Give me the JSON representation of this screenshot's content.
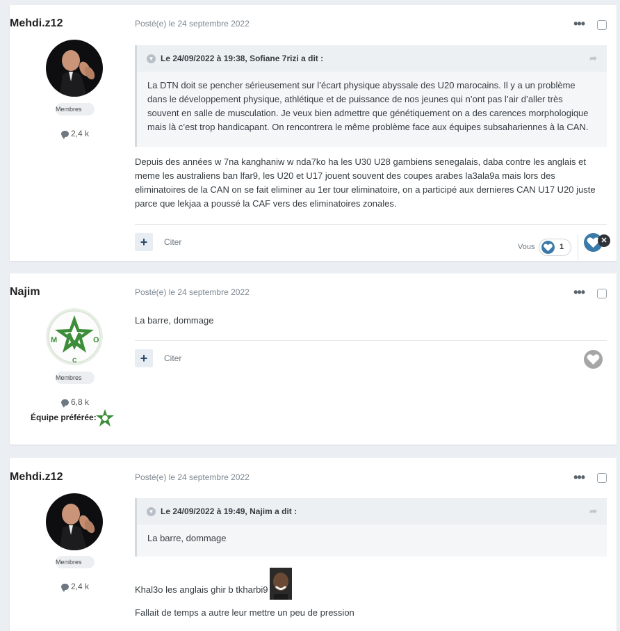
{
  "posts": [
    {
      "author": "Mehdi.z12",
      "role": "Membres",
      "rep": "2,4 k",
      "date": "Posté(e) le 24 septembre 2022",
      "quote": {
        "header": "Le 24/09/2022 à 19:38, Sofiane 7rizi a dit :",
        "body": "La DTN doit se pencher sérieusement sur l’écart physique abyssale des U20 marocains. Il y a un problème dans le développement physique, athlétique et de puissance de nos jeunes qui n’ont pas l’air d’aller très souvent en salle de musculation. Je veux bien admettre que génétiquement on a des carences morphologique mais là c’est trop handicapant. On rencontrera le même problème face aux équipes subsahariennes à la CAN."
      },
      "text": "Depuis des années w 7na kanghaniw w nda7ko ha les U30 U28 gambiens senegalais, daba contre les anglais et meme les australiens ban lfar9, les U20 et U17 jouent souvent des coupes arabes la3ala9a mais lors des eliminatoires de la CAN on se fait eliminer au 1er tour eliminatoire, on a participé aux dernieres CAN U17 U20 juste parce que lekjaa a poussé la CAF vers des eliminatoires zonales.",
      "cite": "Citer",
      "reaction_user": "Vous",
      "reaction_count": "1"
    },
    {
      "author": "Najim",
      "role": "Membres",
      "rep": "6,8 k",
      "fav_label": "Équipe préférée:",
      "date": "Posté(e) le 24 septembre 2022",
      "text": "La barre, dommage",
      "cite": "Citer"
    },
    {
      "author": "Mehdi.z12",
      "role": "Membres",
      "rep": "2,4 k",
      "date": "Posté(e) le 24 septembre 2022",
      "quote": {
        "header": "Le 24/09/2022 à 19:49, Najim a dit :",
        "body": "La barre, dommage"
      },
      "text": "Khal3o les anglais ghir b tkharbi9",
      "text2": "Fallait de temps a autre leur mettre un peu de pression"
    }
  ],
  "logo_letters": {
    "m": "M",
    "o": "O",
    "c": "C"
  },
  "colors": {
    "accent": "#3b7aa8",
    "logo_green": "#3c8d3a",
    "badge_bg": "#eceff2"
  },
  "icons": [
    "comment-icon",
    "ellipsis-icon",
    "chevron-icon",
    "share-icon",
    "plus-icon",
    "heart-icon",
    "close-icon"
  ]
}
